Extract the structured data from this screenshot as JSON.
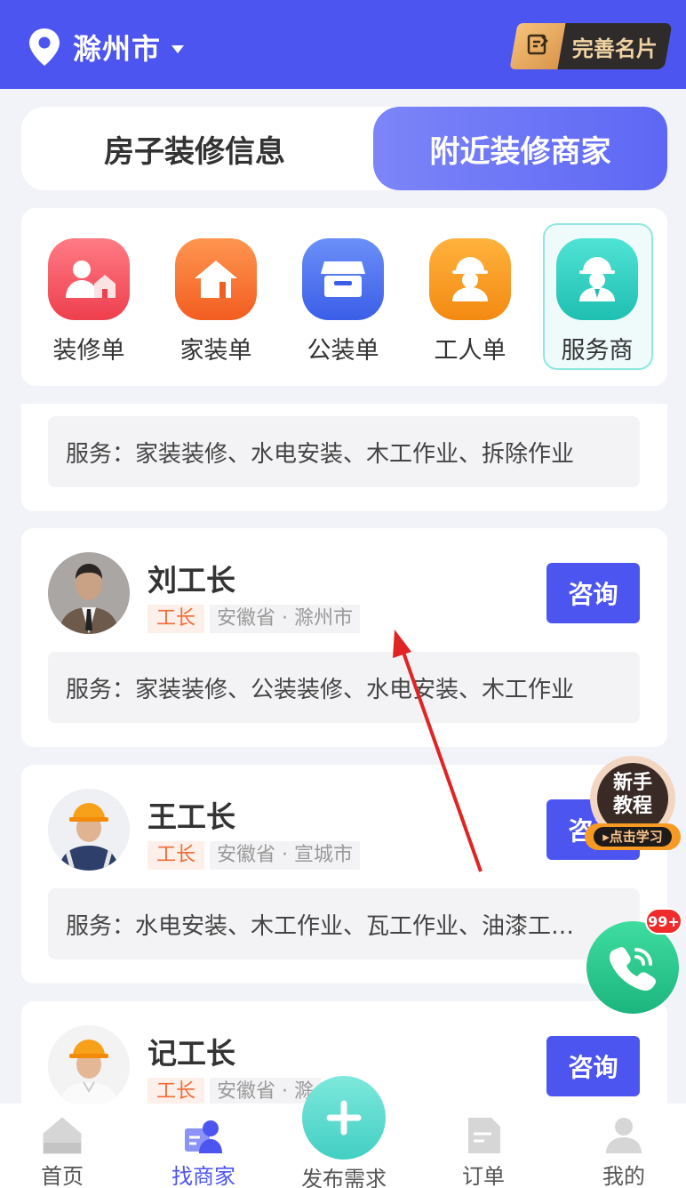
{
  "header": {
    "city": "滁州市",
    "card_button": "完善名片"
  },
  "tabs": [
    {
      "label": "房子装修信息",
      "active": false
    },
    {
      "label": "附近装修商家",
      "active": true
    }
  ],
  "categories": [
    {
      "label": "装修单",
      "icon": "decoration-order-icon",
      "color": "#f0545f"
    },
    {
      "label": "家装单",
      "icon": "home-icon",
      "color": "#f4702d"
    },
    {
      "label": "公装单",
      "icon": "store-icon",
      "color": "#4a72f0"
    },
    {
      "label": "工人单",
      "icon": "worker-icon",
      "color": "#f99a23"
    },
    {
      "label": "服务商",
      "icon": "service-provider-icon",
      "color": "#2ecfc1",
      "selected": true
    }
  ],
  "partial_card": {
    "services": "服务：家装装修、水电安装、木工作业、拆除作业"
  },
  "merchants": [
    {
      "name": "刘工长",
      "role": "工长",
      "location": "安徽省 · 滁州市",
      "services": "服务：家装装修、公装装修、水电安装、木工作业",
      "consult": "咨询"
    },
    {
      "name": "王工长",
      "role": "工长",
      "location": "安徽省 · 宣城市",
      "services": "服务：水电安装、木工作业、瓦工作业、油漆工…",
      "consult": "咨询"
    },
    {
      "name": "记工长",
      "role": "工长",
      "location": "安徽省 · 滁",
      "consult": "咨询"
    }
  ],
  "floating": {
    "tutorial_line1": "新手",
    "tutorial_line2": "教程",
    "tutorial_cta": "▸点击学习",
    "badge": "99+"
  },
  "nav": [
    {
      "label": "首页",
      "active": false
    },
    {
      "label": "找商家",
      "active": true
    },
    {
      "label": "发布需求",
      "active": false
    },
    {
      "label": "订单",
      "active": false
    },
    {
      "label": "我的",
      "active": false
    }
  ],
  "colors": {
    "primary": "#4d55f0",
    "role_tag": "#f06a35",
    "annotation_arrow": "#e02424"
  }
}
